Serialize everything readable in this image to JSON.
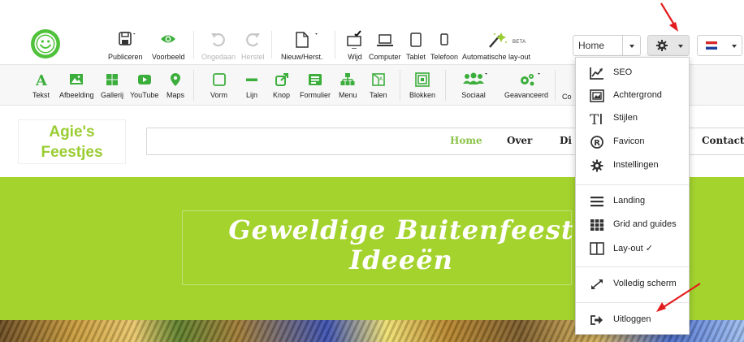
{
  "toolbar": {
    "publish": "Publiceren",
    "preview": "Voorbeeld",
    "undo": "Ongedaan",
    "redo": "Herstel",
    "new": "Nieuw/Herst.",
    "wide": "Wijd",
    "computer": "Computer",
    "tablet": "Tablet",
    "phone": "Telefoon",
    "auto_layout": "Automatische lay-out",
    "beta": "BETA",
    "page_select": "Home"
  },
  "toolbar2": {
    "text": "Tekst",
    "image": "Afbeelding",
    "gallery": "Gallerij",
    "youtube": "YouTube",
    "maps": "Maps",
    "shape": "Vorm",
    "line": "Lijn",
    "button": "Knop",
    "form": "Formulier",
    "menu": "Menu",
    "languages": "Talen",
    "blocks": "Blokken",
    "social": "Sociaal",
    "advanced": "Geavanceerd",
    "more": "Co"
  },
  "dropdown": {
    "items": [
      {
        "label": "SEO",
        "icon": "chart-line-icon"
      },
      {
        "label": "Achtergrond",
        "icon": "background-icon"
      },
      {
        "label": "Stijlen",
        "icon": "text-styles-icon"
      },
      {
        "label": "Favicon",
        "icon": "registered-icon"
      },
      {
        "label": "Instellingen",
        "icon": "gear-icon"
      },
      {
        "label": "Landing",
        "icon": "hamburger-icon"
      },
      {
        "label": "Grid and guides",
        "icon": "grid-icon"
      },
      {
        "label": "Lay-out ✓",
        "icon": "columns-icon"
      },
      {
        "label": "Volledig scherm",
        "icon": "expand-icon"
      },
      {
        "label": "Uitloggen",
        "icon": "logout-icon"
      }
    ]
  },
  "site": {
    "brand_line1": "Agie's",
    "brand_line2": "Feestjes",
    "nav": [
      "Home",
      "Over",
      "Di",
      "Contact"
    ],
    "hero_line1": "Geweldige Buitenfeest",
    "hero_line2": "Ideeën"
  },
  "colors": {
    "brand_green": "#8bc34a",
    "hero_green": "#a4d32e",
    "arrow_red": "#e31b1b"
  }
}
